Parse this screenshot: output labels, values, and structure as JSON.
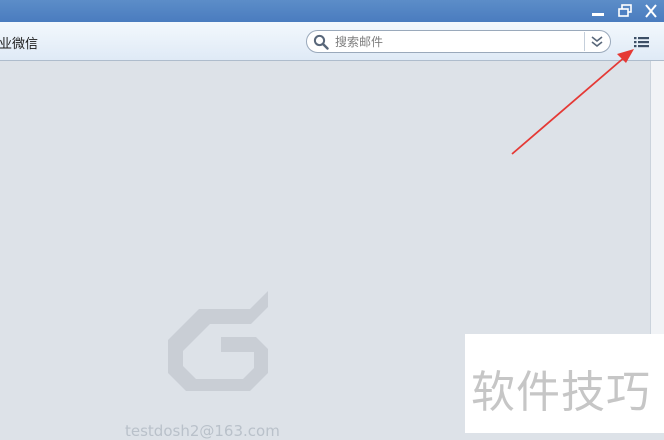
{
  "window": {
    "controls": [
      "minimize-icon",
      "restore-icon",
      "close-icon"
    ]
  },
  "toolbar": {
    "label": "业微信",
    "search": {
      "placeholder": "搜索邮件"
    },
    "menu_icon": "list-menu-icon"
  },
  "content": {
    "account": "testdosh2@163.com",
    "logo_icon": "mail-logo-icon"
  },
  "watermark": {
    "text": "软件技巧"
  },
  "annotation": {
    "color": "#e53935"
  },
  "colors": {
    "titlebar": "#4a7cbf",
    "content_bg": "#dde2e8",
    "logo": "#c9ced5"
  }
}
